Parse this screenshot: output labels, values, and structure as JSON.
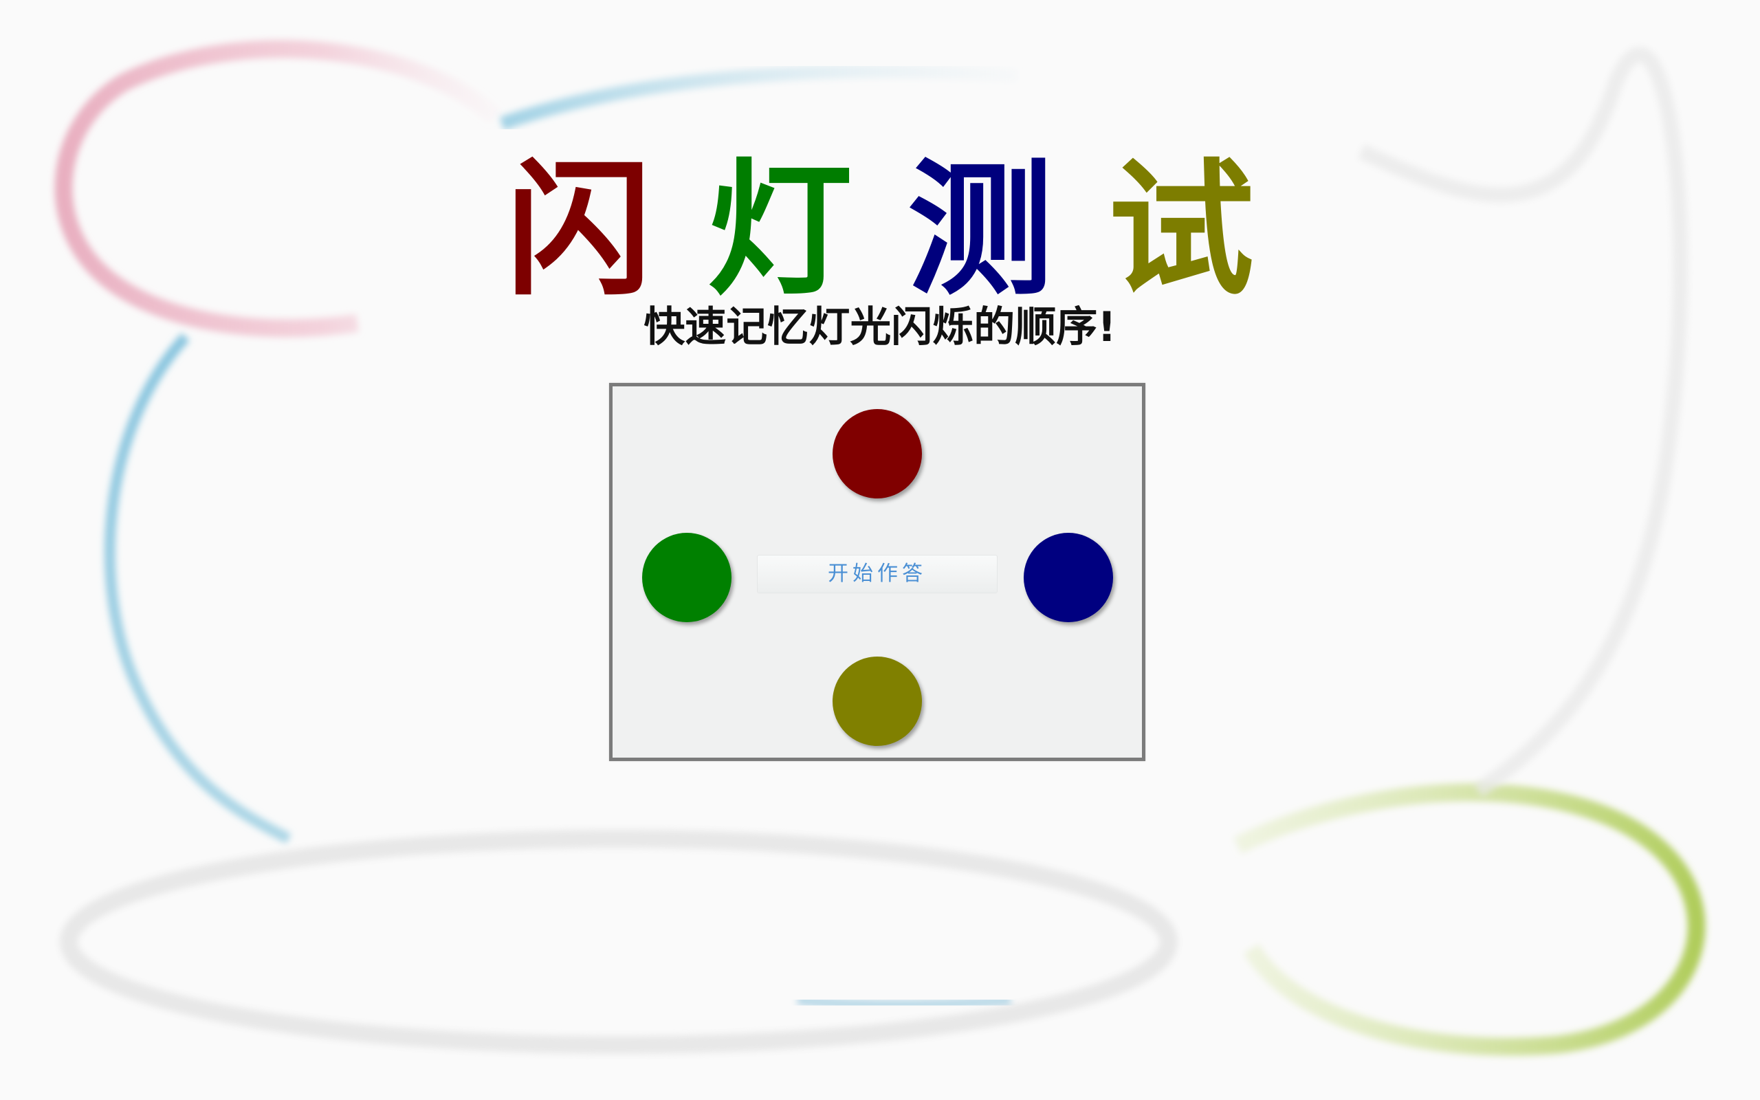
{
  "title": {
    "chars": [
      {
        "text": "闪",
        "color": "#7d0000"
      },
      {
        "text": "灯",
        "color": "#007d00"
      },
      {
        "text": "测",
        "color": "#00007d"
      },
      {
        "text": "试",
        "color": "#7d7d00"
      }
    ]
  },
  "subtitle": "快速记忆灯光闪烁的顺序!",
  "board": {
    "lamps": {
      "top": {
        "color": "#800000"
      },
      "left": {
        "color": "#008000"
      },
      "right": {
        "color": "#000080"
      },
      "bottom": {
        "color": "#808000"
      }
    },
    "start_button_label": "开始作答"
  },
  "background": {
    "swirl_colors": [
      "#e8a4b8",
      "#8ec9e0",
      "#e6e6e6",
      "#b5cf5a"
    ]
  }
}
